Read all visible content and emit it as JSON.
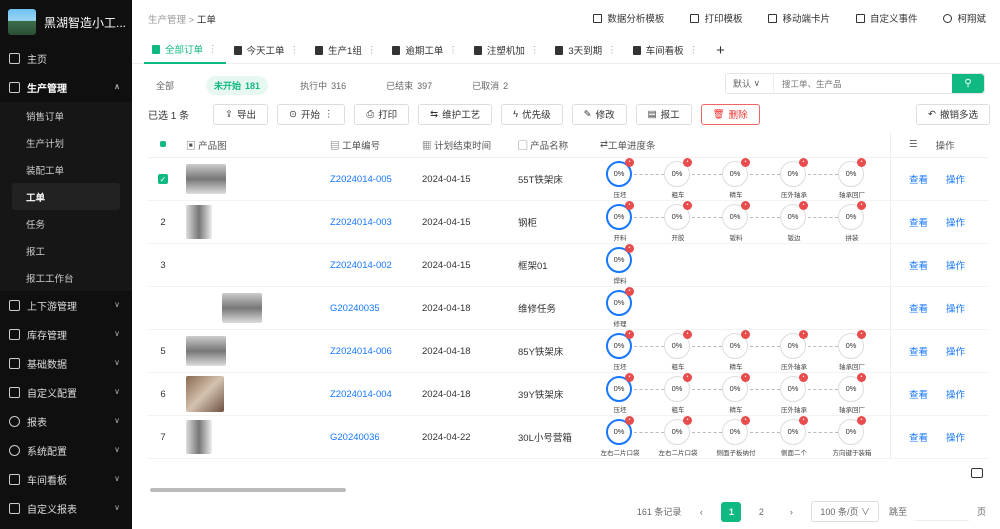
{
  "app": {
    "title": "黑湖智造小工..."
  },
  "sidebar": {
    "items": [
      {
        "label": "主页",
        "expanded": false
      },
      {
        "label": "生产管理",
        "expanded": true
      }
    ],
    "sub_items": [
      "销售订单",
      "生产计划",
      "装配工单",
      "工单",
      "任务",
      "报工",
      "报工工作台"
    ],
    "selected_sub": "工单",
    "items_after": [
      "上下游管理",
      "库存管理",
      "基础数据",
      "自定义配置",
      "报表",
      "系统配置",
      "车间看板",
      "自定义报表"
    ]
  },
  "breadcrumb": {
    "parent": "生产管理",
    "sep": ">",
    "current": "工单"
  },
  "top_actions": [
    "数据分析模板",
    "打印模板",
    "移动端卡片",
    "自定义事件",
    "柯翔斌"
  ],
  "tabs": [
    {
      "label": "全部订单",
      "active": true
    },
    {
      "label": "今天工单",
      "active": false
    },
    {
      "label": "生产1组",
      "active": false
    },
    {
      "label": "逾期工单",
      "active": false
    },
    {
      "label": "注塑机加",
      "active": false
    },
    {
      "label": "3天到期",
      "active": false
    },
    {
      "label": "车间看板",
      "active": false
    }
  ],
  "tab_add": "+",
  "status_filters": [
    {
      "label": "全部",
      "count": ""
    },
    {
      "label": "未开始",
      "count": "181"
    },
    {
      "label": "执行中",
      "count": "316"
    },
    {
      "label": "已结束",
      "count": "397"
    },
    {
      "label": "已取消",
      "count": "2"
    }
  ],
  "search": {
    "select": "默认",
    "placeholder": "搜工单、生产品"
  },
  "toolbar": {
    "selected": "已选 1 条",
    "buttons": [
      "导出",
      "开始",
      "打印",
      "维护工艺",
      "优先级",
      "修改",
      "报工",
      "删除"
    ],
    "undo": "撤销多选"
  },
  "table": {
    "headers": [
      "产品图",
      "工单编号",
      "计划结束时间",
      "产品名称",
      "工单进度条",
      "操作"
    ],
    "rows": [
      {
        "idx": "",
        "checked": true,
        "img": "wide",
        "code": "Z2024014-005",
        "date": "2024-04-15",
        "name": "55T铁架床",
        "steps": [
          "压坯",
          "粗车",
          "精车",
          "压外轴承",
          "轴承回厂"
        ],
        "view": "查看",
        "op": "操作"
      },
      {
        "idx": "2",
        "checked": false,
        "img": "tall",
        "code": "Z2024014-003",
        "date": "2024-04-15",
        "name": "钢柜",
        "steps": [
          "开料",
          "开胶",
          "钣料",
          "钣边",
          "拼装"
        ],
        "view": "查看",
        "op": "操作"
      },
      {
        "idx": "3",
        "checked": false,
        "img": "",
        "code": "Z2024014-002",
        "date": "2024-04-15",
        "name": "框架01",
        "steps": [
          "焊料"
        ],
        "view": "查看",
        "op": "操作"
      },
      {
        "idx": "",
        "checked": false,
        "img": "wide-offset",
        "code": "G20240035",
        "date": "2024-04-18",
        "name": "维修任务",
        "steps": [
          "修理"
        ],
        "view": "查看",
        "op": "操作"
      },
      {
        "idx": "5",
        "checked": false,
        "img": "wide",
        "code": "Z2024014-006",
        "date": "2024-04-18",
        "name": "85Y铁架床",
        "steps": [
          "压坯",
          "粗车",
          "精车",
          "压外轴承",
          "轴承回厂"
        ],
        "view": "查看",
        "op": "操作"
      },
      {
        "idx": "6",
        "checked": false,
        "img": "brown",
        "code": "Z2024014-004",
        "date": "2024-04-18",
        "name": "39Y铁架床",
        "steps": [
          "压坯",
          "粗车",
          "精车",
          "压外轴承",
          "轴承回厂"
        ],
        "view": "查看",
        "op": "操作"
      },
      {
        "idx": "7",
        "checked": false,
        "img": "tall",
        "code": "G20240036",
        "date": "2024-04-22",
        "name": "30L小号营箱",
        "steps": [
          "左右二片口袋",
          "左右二片口袋",
          "侧面子板纳付",
          "侧面二个",
          "方向键于装箱"
        ],
        "view": "查看",
        "op": "操作"
      }
    ],
    "progress_value": "0%"
  },
  "pagination": {
    "total": "161 条记录",
    "pages": [
      "1",
      "2"
    ],
    "current": "1",
    "per_page": "100 条/页",
    "jump": "跳至",
    "page_suffix": "页"
  }
}
